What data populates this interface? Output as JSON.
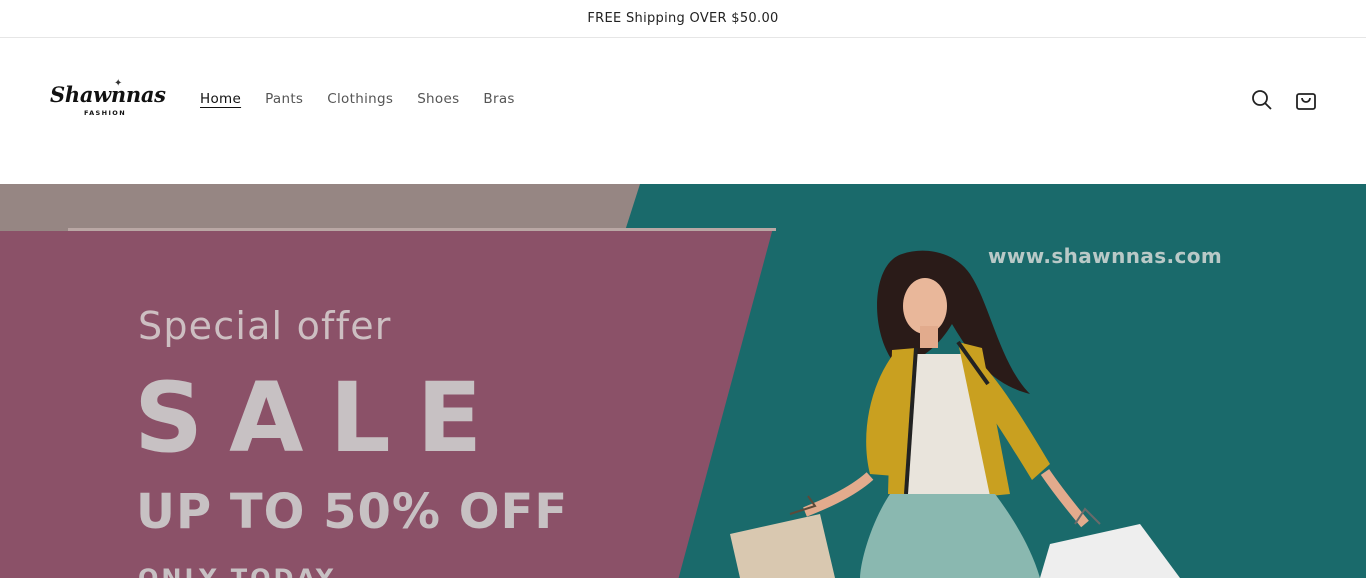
{
  "announcement": {
    "text": "FREE Shipping OVER $50.00"
  },
  "brand": {
    "name": "Shawnnas",
    "tagline": "FASHION"
  },
  "nav": {
    "items": [
      {
        "label": "Home",
        "active": true
      },
      {
        "label": "Pants",
        "active": false
      },
      {
        "label": "Clothings",
        "active": false
      },
      {
        "label": "Shoes",
        "active": false
      },
      {
        "label": "Bras",
        "active": false
      }
    ]
  },
  "header_icons": {
    "search": "search-icon",
    "cart": "cart-icon"
  },
  "hero": {
    "special": "Special offer",
    "sale": "SALE",
    "discount": "UP TO 50% OFF",
    "today": "ONLY TODAY",
    "url": "www.shawnnas.com"
  },
  "colors": {
    "teal": "#1a6a6b",
    "pink": "#8b5168",
    "tan": "#968683",
    "jacket": "#c9a020"
  }
}
